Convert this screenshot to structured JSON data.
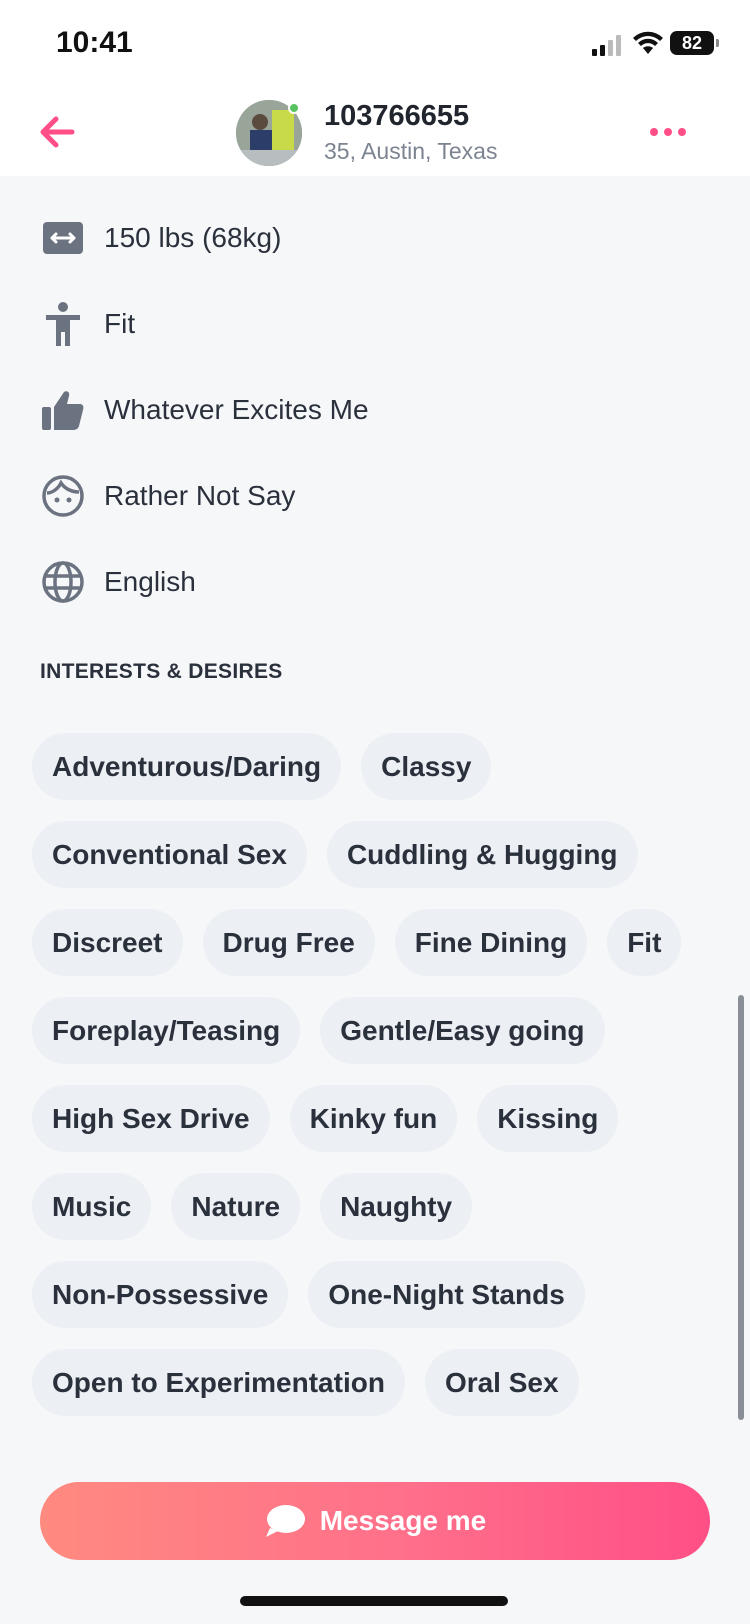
{
  "status_bar": {
    "time": "10:41",
    "battery": "82"
  },
  "header": {
    "name": "103766655",
    "location": "35, Austin, Texas",
    "accent_color": "#ff4f86"
  },
  "attributes": [
    {
      "icon": "weight-icon",
      "label": "150 lbs (68kg)"
    },
    {
      "icon": "body-type-icon",
      "label": "Fit"
    },
    {
      "icon": "thumbs-up-icon",
      "label": "Whatever Excites Me"
    },
    {
      "icon": "face-icon",
      "label": "Rather Not Say"
    },
    {
      "icon": "globe-icon",
      "label": "English"
    }
  ],
  "interests": {
    "title": "INTERESTS & DESIRES",
    "items": [
      "Adventurous/Daring",
      "Classy",
      "Conventional Sex",
      "Cuddling & Hugging",
      "Discreet",
      "Drug Free",
      "Fine Dining",
      "Fit",
      "Foreplay/Teasing",
      "Gentle/Easy going",
      "High Sex Drive",
      "Kinky fun",
      "Kissing",
      "Music",
      "Nature",
      "Naughty",
      "Non-Possessive",
      "One-Night Stands",
      "Open to Experimentation",
      "Oral Sex"
    ]
  },
  "message_button": {
    "label": "Message me"
  }
}
